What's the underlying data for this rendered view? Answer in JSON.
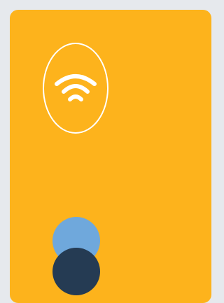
{
  "card": {
    "background_color": "#fdb31c",
    "page_background_color": "#e6e9ed"
  },
  "contactless_icon": {
    "icon": "contactless-wifi-icon",
    "stroke_color": "#ffffff"
  },
  "payment_dots": {
    "top_color": "#6fa8dc",
    "bottom_color": "#253b53"
  }
}
